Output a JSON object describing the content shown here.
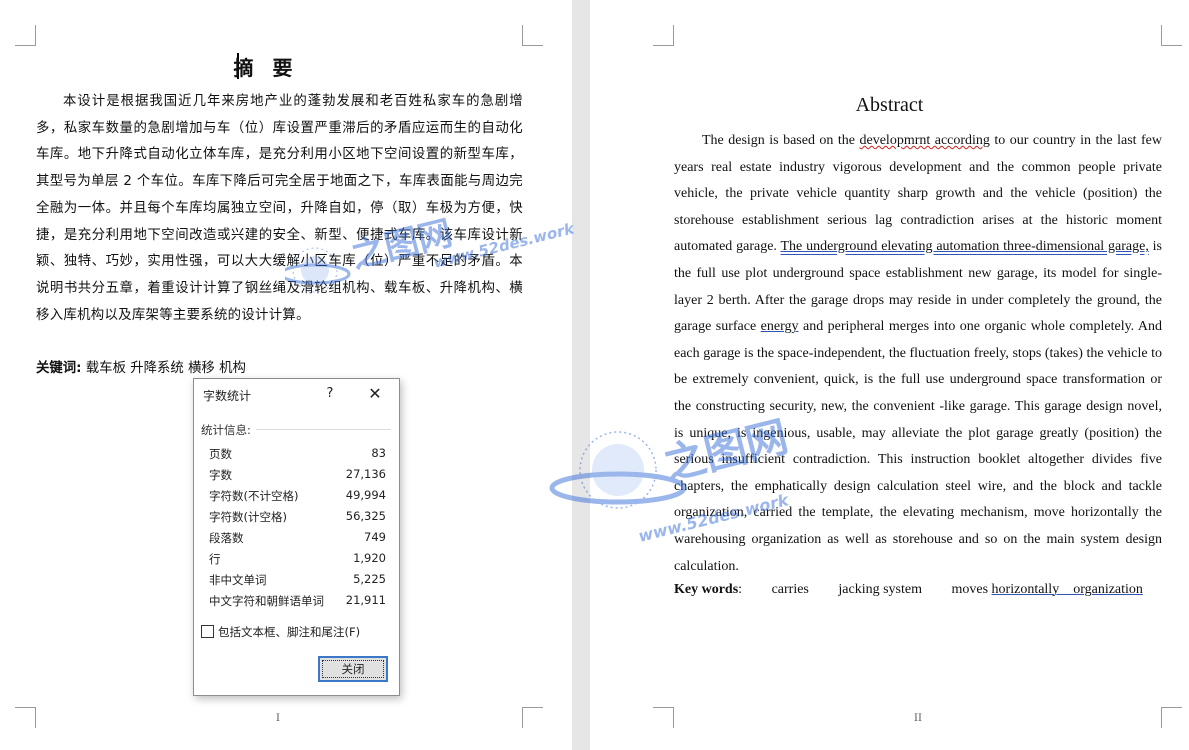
{
  "left_page": {
    "title": "摘 要",
    "body": "本设计是根据我国近几年来房地产业的蓬勃发展和老百姓私家车的急剧增多，私家车数量的急剧增加与车（位）库设置严重滞后的矛盾应运而生的自动化车库。地下升降式自动化立体车库，是充分利用小区地下空间设置的新型车库，其型号为单层 2 个车位。车库下降后可完全居于地面之下，车库表面能与周边完全融为一体。并且每个车库均属独立空间，升降自如，停（取）车极为方便，快捷，是充分利用地下空间改造或兴建的安全、新型、便捷式车库。该车库设计新颖、独特、巧妙，实用性强，可以大大缓解小区车库（位）严重不足的矛盾。本说明书共分五章，着重设计计算了钢丝绳及滑轮组机构、载车板、升降机构、横移入库机构以及库架等主要系统的设计计算。",
    "keywords_label": "关键词:",
    "keywords": "载车板  升降系统  横移  机构",
    "page_number": "I"
  },
  "right_page": {
    "title": "Abstract",
    "body_parts": {
      "p1": "The design is based on the ",
      "p2": "developmrnt   according",
      "p3": " to our country in the last few years real estate industry vigorous development and the common people private vehicle, the private vehicle quantity sharp growth and the vehicle (position) the storehouse establishment serious lag contradiction arises at the historic moment automated garage. ",
      "p4": "The underground elevating automation three-dimensional garage,",
      "p5": " is the full use plot underground space establishment new garage, its model for single-layer 2 berth. After the garage drops may reside in under completely the ground, the garage surface ",
      "p6": "energy",
      "p7": " and peripheral merges into one organic whole completely. And each garage is the space-independent, the fluctuation freely, stops (takes) the vehicle to be extremely convenient, quick, is the full use underground space transformation or the constructing security, new, the convenient -like garage. This garage design novel, is unique, is ingenious, usable, may alleviate the plot garage greatly (position) the serious insufficient contradiction. This instruction booklet altogether divides five chapters, the emphatically design calculation steel wire, and the block and tackle organization, carried the template, the elevating mechanism, move horizontally the warehousing organization as well as storehouse and so on the main system design calculation."
    },
    "keywords_label": "Key words",
    "keywords_colon": ":",
    "keywords": [
      "carries",
      "jacking system",
      "moves",
      "horizontally    organization"
    ],
    "page_number": "II"
  },
  "dialog": {
    "title": "字数统计",
    "help": "?",
    "close": "✕",
    "section": "统计信息:",
    "stats": [
      {
        "label": "页数",
        "value": "83"
      },
      {
        "label": "字数",
        "value": "27,136"
      },
      {
        "label": "字符数(不计空格)",
        "value": "49,994"
      },
      {
        "label": "字符数(计空格)",
        "value": "56,325"
      },
      {
        "label": "段落数",
        "value": "749"
      },
      {
        "label": "行",
        "value": "1,920"
      },
      {
        "label": "非中文单词",
        "value": "5,225"
      },
      {
        "label": "中文字符和朝鲜语单词",
        "value": "21,911"
      }
    ],
    "checkbox_label": "包括文本框、脚注和尾注(F)",
    "button": "关闭"
  },
  "watermark": {
    "text_cn": "之图网",
    "text_url": "www.52des.work",
    "color": "#3a6fd8"
  }
}
